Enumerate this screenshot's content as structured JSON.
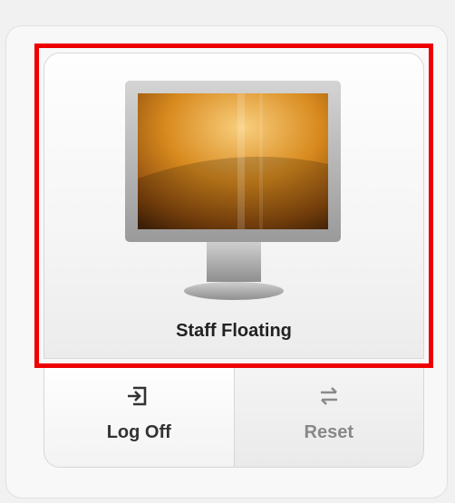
{
  "desktop": {
    "name": "Staff Floating",
    "icon": "monitor-icon",
    "selected": true
  },
  "actions": [
    {
      "label": "Log Off",
      "icon": "log-off-icon",
      "enabled": true
    },
    {
      "label": "Reset",
      "icon": "reset-icon",
      "enabled": false
    }
  ],
  "colors": {
    "highlight": "#ee0000",
    "screen": "#d88a1e"
  }
}
